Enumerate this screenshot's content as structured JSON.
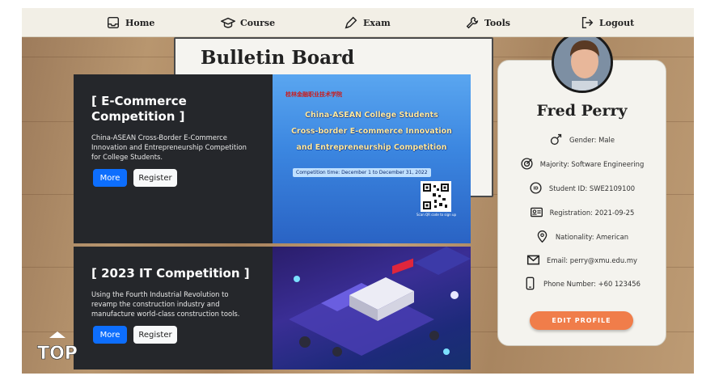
{
  "nav": {
    "home": "Home",
    "course": "Course",
    "exam": "Exam",
    "tools": "Tools",
    "logout": "Logout"
  },
  "board_title": "Bulletin Board",
  "cards": [
    {
      "title": "[ E-Commerce Competition ]",
      "desc": "China-ASEAN Cross-Border E-Commerce Innovation and Entrepreneurship Competition for College Students.",
      "more": "More",
      "register": "Register",
      "poster": {
        "logo": "桂林金融职业技术学院",
        "line1": "China-ASEAN College Students",
        "line2": "Cross-border E-commerce Innovation",
        "line3": "and Entrepreneurship Competition",
        "time": "Competition time:  December 1 to December 31, 2022",
        "qr_caption": "Scan QR code to sign up"
      }
    },
    {
      "title": "[ 2023 IT Competition ]",
      "desc": "Using the Fourth Industrial Revolution to revamp the construction industry and manufacture world-class construction tools.",
      "more": "More",
      "register": "Register"
    }
  ],
  "profile": {
    "name": "Fred Perry",
    "gender": "Gender: Male",
    "majority": "Majority: Software Engineering",
    "student_id": "Student ID: SWE2109100",
    "registration": "Registration: 2021-09-25",
    "nationality": "Nationality: American",
    "email": "Email: perry@xmu.edu.my",
    "phone": "Phone Number: +60 123456",
    "edit_label": "EDIT PROFILE"
  },
  "top_logo": "TOP",
  "colors": {
    "accent_blue": "#0d6efd",
    "edit_orange": "#f07d4a",
    "card_dark": "#25272b"
  }
}
